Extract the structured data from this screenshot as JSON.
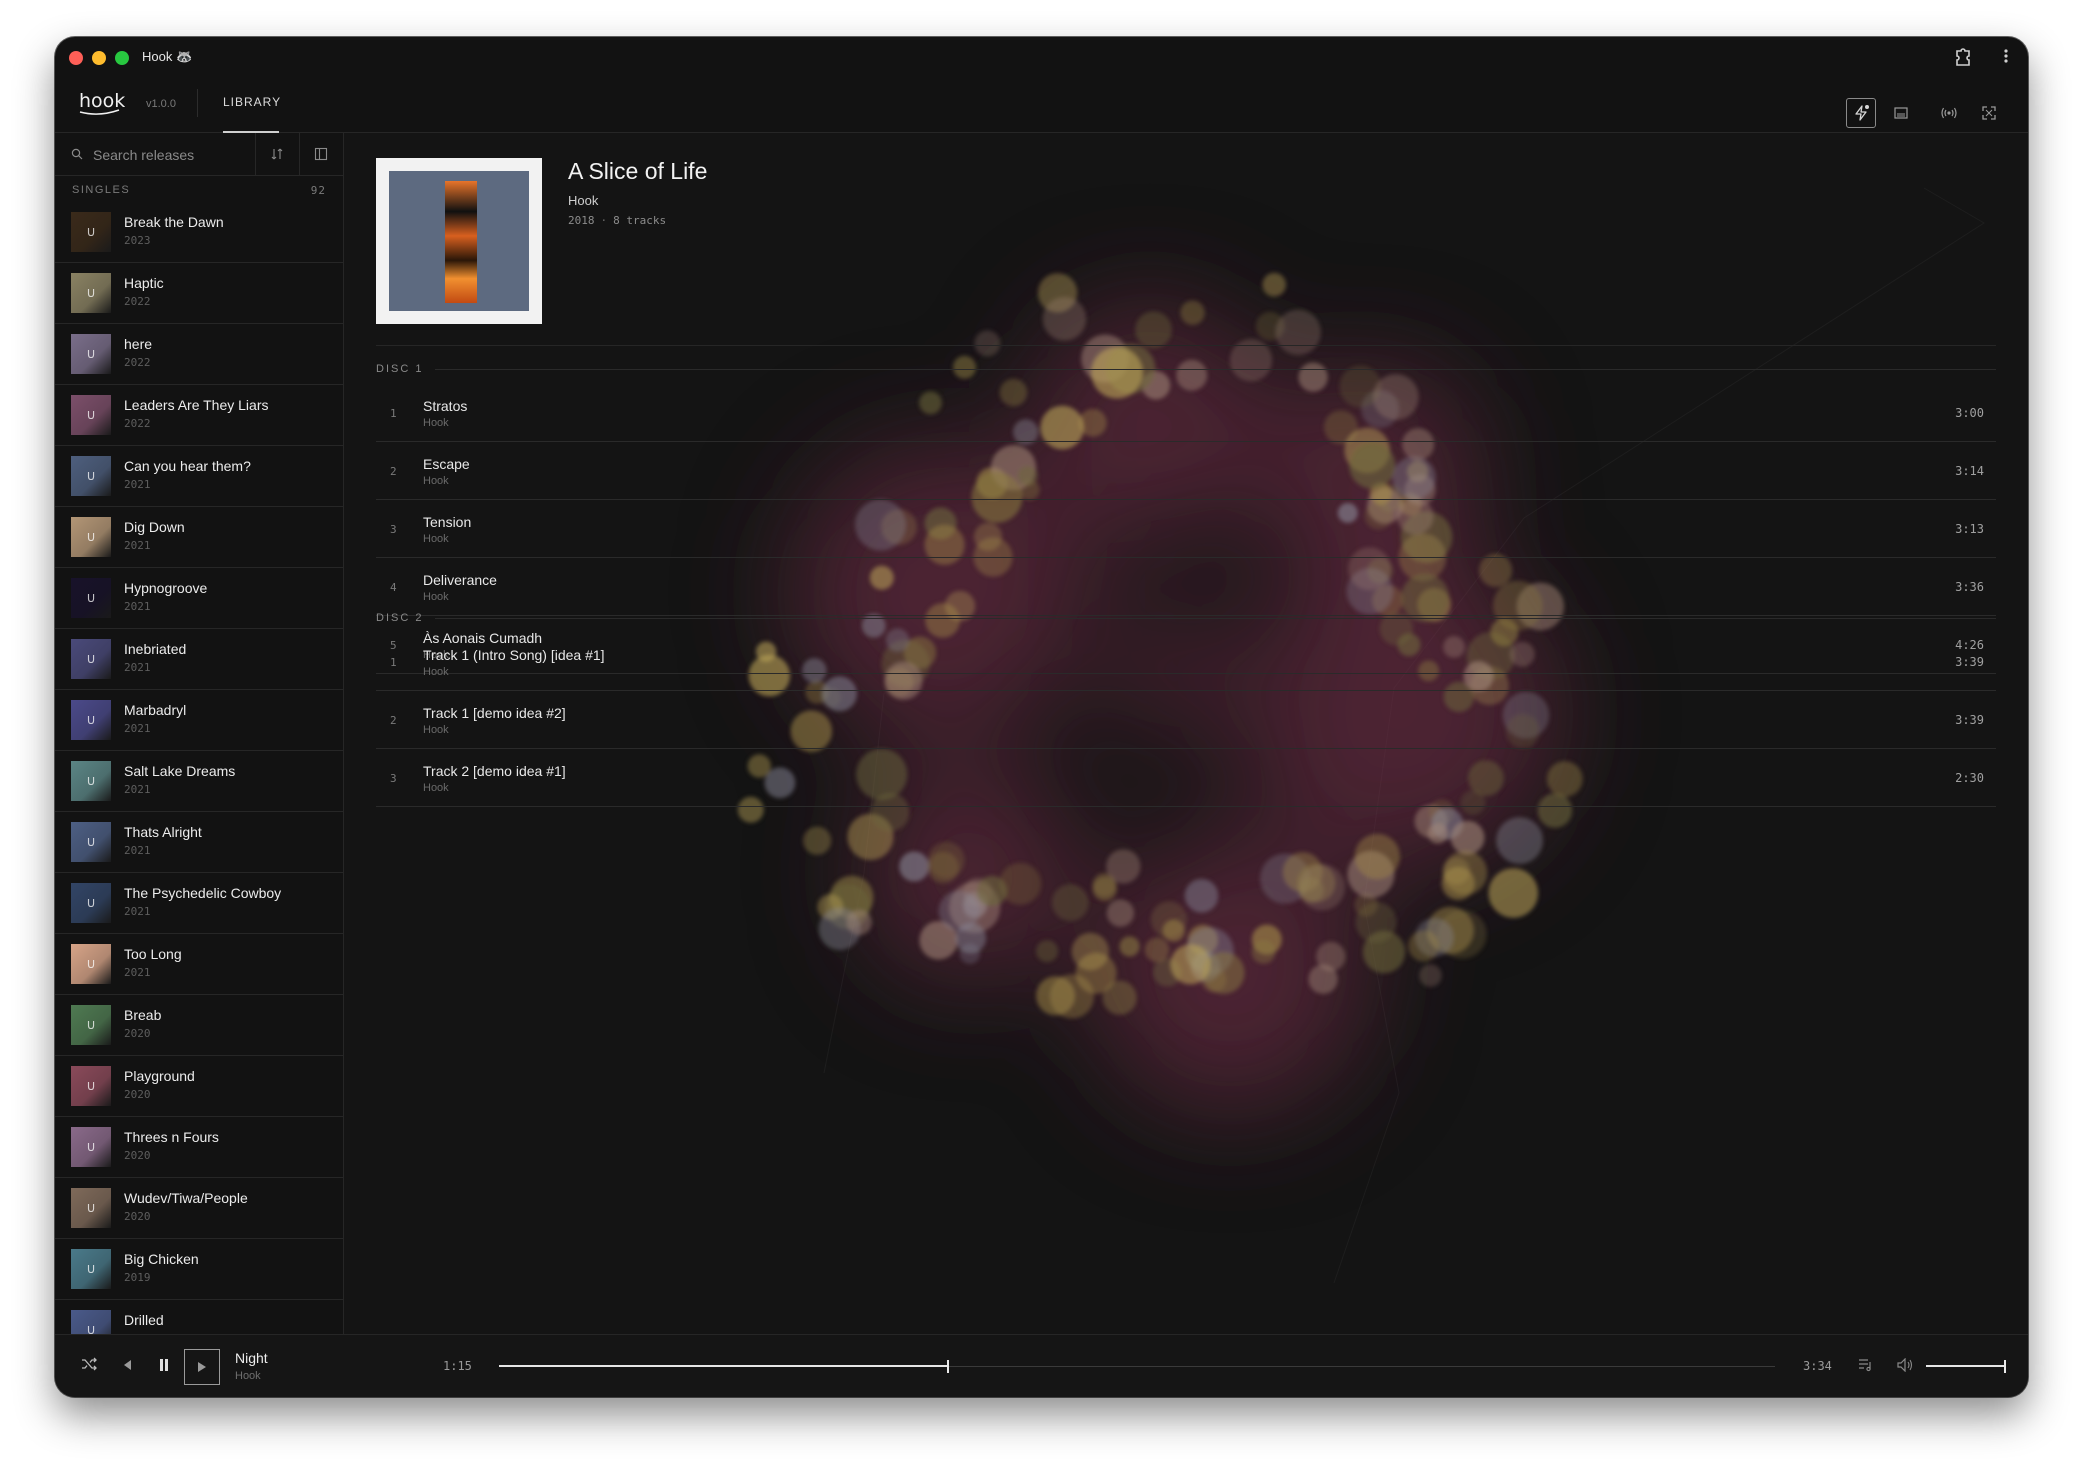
{
  "window": {
    "title": "Hook",
    "title_emoji": "🦝"
  },
  "header": {
    "logo": "hook",
    "version": "v1.0.0",
    "tabs": [
      {
        "label": "LIBRARY",
        "active": true
      }
    ],
    "buttons": [
      "lightning-icon",
      "display-icon",
      "broadcast-icon",
      "fullscreen-icon"
    ]
  },
  "sidebar": {
    "search_placeholder": "Search releases",
    "section": {
      "label": "SINGLES",
      "count": "92"
    },
    "releases": [
      {
        "title": "Break the Dawn",
        "year": "2023",
        "color": "#3a2a1a"
      },
      {
        "title": "Haptic",
        "year": "2022",
        "color": "#8a8263"
      },
      {
        "title": "here",
        "year": "2022",
        "color": "#7a6e8a"
      },
      {
        "title": "Leaders Are They Liars",
        "year": "2022",
        "color": "#7c4f6a"
      },
      {
        "title": "Can you hear them?",
        "year": "2021",
        "color": "#4e5f7e"
      },
      {
        "title": "Dig Down",
        "year": "2021",
        "color": "#b39676"
      },
      {
        "title": "Hypnogroove",
        "year": "2021",
        "color": "#18122a"
      },
      {
        "title": "Inebriated",
        "year": "2021",
        "color": "#4a4a7a"
      },
      {
        "title": "Marbadryl",
        "year": "2021",
        "color": "#4b4a8a"
      },
      {
        "title": "Salt Lake Dreams",
        "year": "2021",
        "color": "#5b8585"
      },
      {
        "title": "Thats Alright",
        "year": "2021",
        "color": "#4d5f84"
      },
      {
        "title": "The Psychedelic Cowboy",
        "year": "2021",
        "color": "#324566"
      },
      {
        "title": "Too Long",
        "year": "2021",
        "color": "#d7a488"
      },
      {
        "title": "Breab",
        "year": "2020",
        "color": "#4f7a52"
      },
      {
        "title": "Playground",
        "year": "2020",
        "color": "#8a4a5a"
      },
      {
        "title": "Threes n Fours",
        "year": "2020",
        "color": "#8a6a8a"
      },
      {
        "title": "Wudev/Tiwa/People",
        "year": "2020",
        "color": "#7f6a5a"
      },
      {
        "title": "Big Chicken",
        "year": "2019",
        "color": "#4a7a8a"
      },
      {
        "title": "Drilled",
        "year": "",
        "color": "#4a5a8a"
      }
    ]
  },
  "album": {
    "title": "A Slice of Life",
    "artist": "Hook",
    "year": "2018",
    "track_count": "8 tracks",
    "discs": [
      {
        "label": "DISC 1",
        "tracks": [
          {
            "num": "1",
            "title": "Stratos",
            "artist": "Hook",
            "duration": "3:00"
          },
          {
            "num": "2",
            "title": "Escape",
            "artist": "Hook",
            "duration": "3:14"
          },
          {
            "num": "3",
            "title": "Tension",
            "artist": "Hook",
            "duration": "3:13"
          },
          {
            "num": "4",
            "title": "Deliverance",
            "artist": "Hook",
            "duration": "3:36"
          },
          {
            "num": "5",
            "title": "Às Aonais Cumadh",
            "artist": "Hook",
            "duration": "4:26"
          }
        ]
      },
      {
        "label": "DISC 2",
        "tracks": [
          {
            "num": "1",
            "title": "Track 1 (Intro Song) [idea #1]",
            "artist": "Hook",
            "duration": "3:39"
          },
          {
            "num": "2",
            "title": "Track 1 [demo idea #2]",
            "artist": "Hook",
            "duration": "3:39"
          },
          {
            "num": "3",
            "title": "Track 2 [demo idea #1]",
            "artist": "Hook",
            "duration": "2:30"
          }
        ]
      }
    ]
  },
  "player": {
    "now_playing": {
      "title": "Night",
      "artist": "Hook"
    },
    "elapsed": "1:15",
    "total": "3:34",
    "progress": 0.352,
    "volume": 1.0
  }
}
